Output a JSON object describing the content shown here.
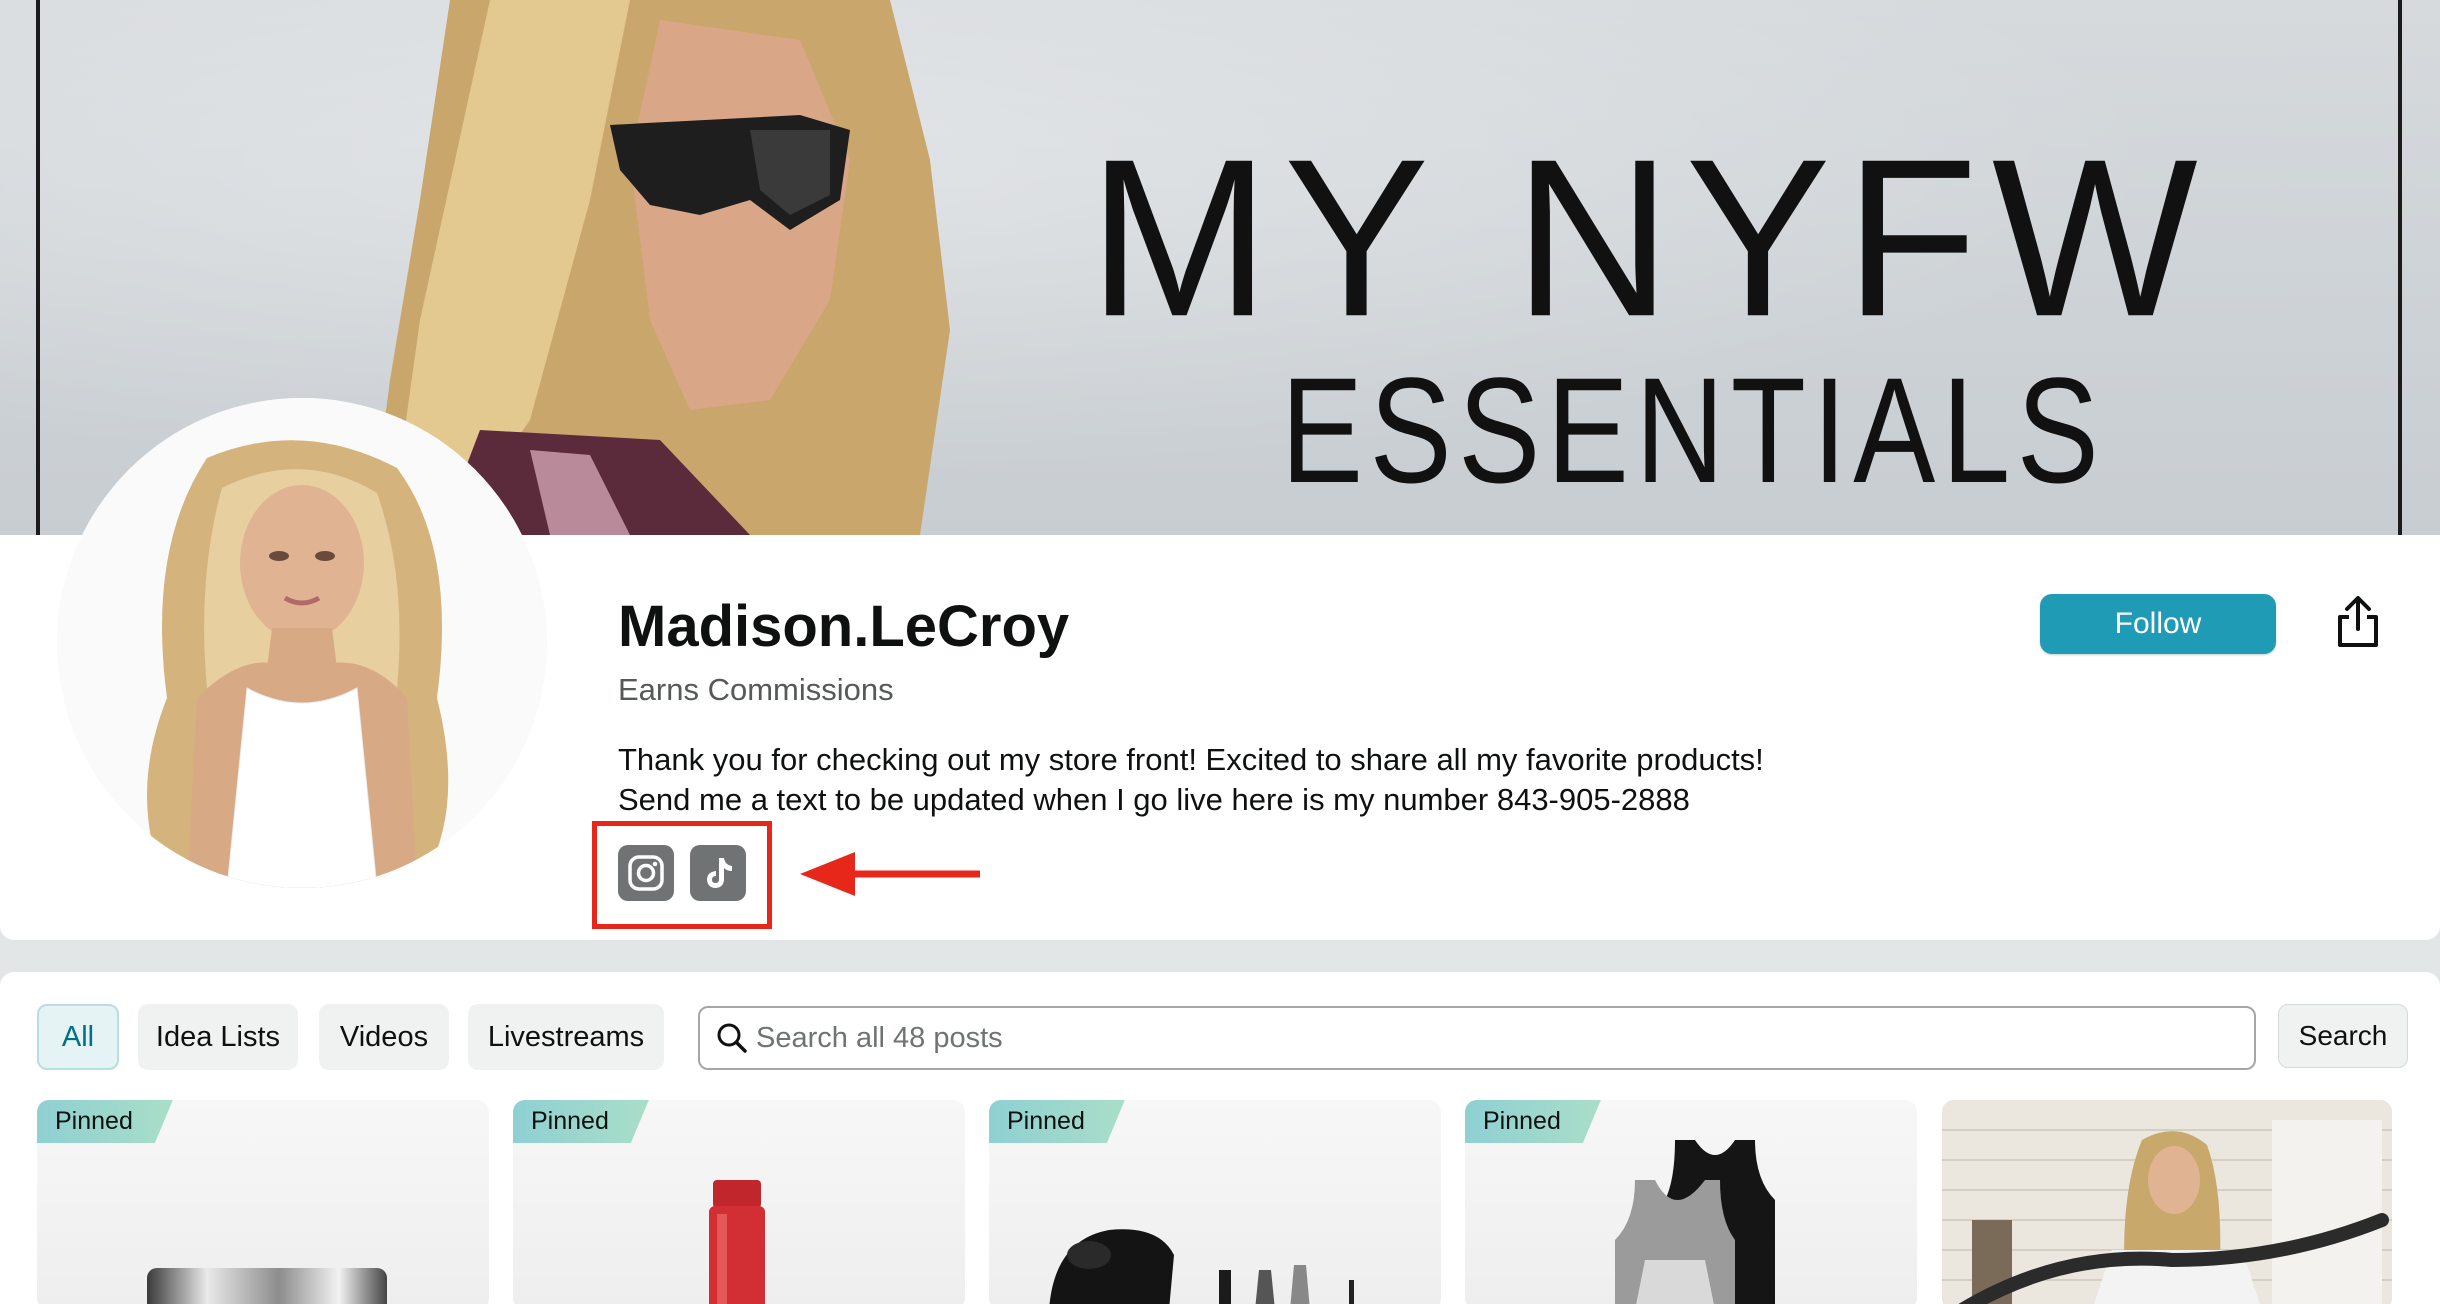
{
  "banner": {
    "headline": "MY NYFW",
    "subheadline": "ESSENTIALS"
  },
  "profile": {
    "name": "Madison.LeCroy",
    "subtitle": "Earns Commissions",
    "bio_line1": "Thank you for checking out my store front! Excited to share all my favorite products!",
    "bio_line2": "Send me a text to be updated when I go live here is my number 843-905-2888",
    "follow_label": "Follow",
    "social_icons": [
      "instagram-icon",
      "tiktok-icon"
    ]
  },
  "filters": [
    {
      "label": "All",
      "active": true
    },
    {
      "label": "Idea Lists",
      "active": false
    },
    {
      "label": "Videos",
      "active": false
    },
    {
      "label": "Livestreams",
      "active": false
    }
  ],
  "search": {
    "placeholder": "Search all 48 posts",
    "button_label": "Search"
  },
  "posts": [
    {
      "badge": "Pinned"
    },
    {
      "badge": "Pinned"
    },
    {
      "badge": "Pinned"
    },
    {
      "badge": "Pinned"
    },
    {
      "badge": ""
    }
  ],
  "colors": {
    "accent": "#1f9bb5",
    "highlight": "#e8271b",
    "pinned": "#8fd0d3"
  }
}
